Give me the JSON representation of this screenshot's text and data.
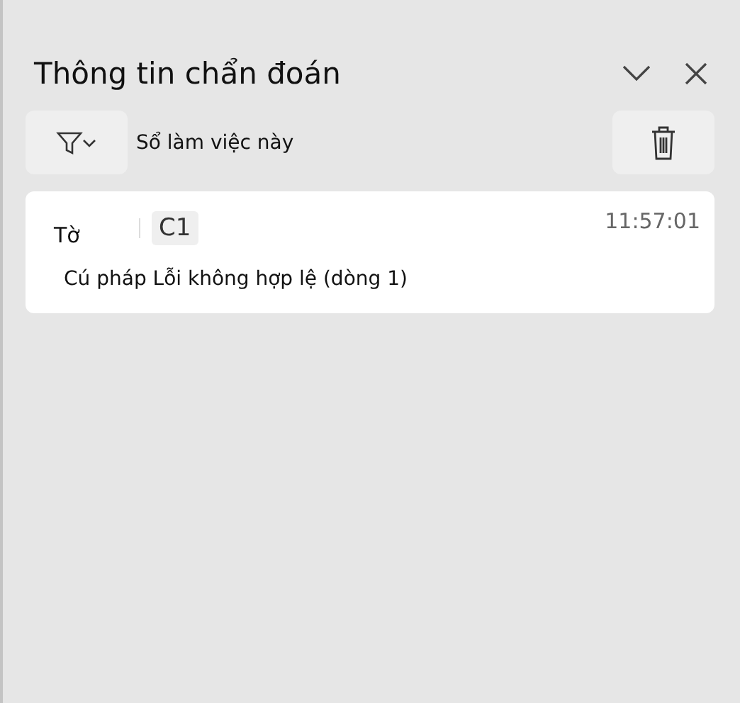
{
  "panel": {
    "title": "Thông tin chẩn đoán"
  },
  "toolbar": {
    "scope": "Sổ làm việc này"
  },
  "entries": [
    {
      "sheet": "Tờ",
      "cell": "C1",
      "time": "11:57:01",
      "message": "Cú pháp Lỗi không hợp lệ (dòng 1)"
    }
  ]
}
